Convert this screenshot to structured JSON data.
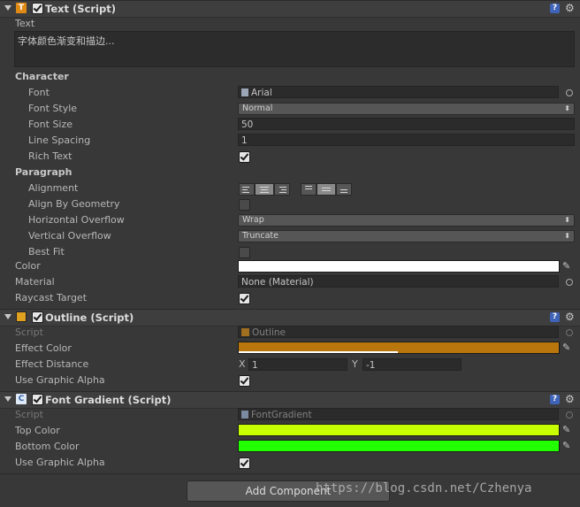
{
  "text_component": {
    "title": "Text (Script)",
    "icon_letter": "T",
    "text_label": "Text",
    "text_value": "字体颜色渐变和描边...",
    "character_section": "Character",
    "font_label": "Font",
    "font_value": "Arial",
    "font_style_label": "Font Style",
    "font_style_value": "Normal",
    "font_size_label": "Font Size",
    "font_size_value": "50",
    "line_spacing_label": "Line Spacing",
    "line_spacing_value": "1",
    "rich_text_label": "Rich Text",
    "rich_text_checked": true,
    "paragraph_section": "Paragraph",
    "alignment_label": "Alignment",
    "align_by_geometry_label": "Align By Geometry",
    "align_by_geometry_checked": false,
    "h_overflow_label": "Horizontal Overflow",
    "h_overflow_value": "Wrap",
    "v_overflow_label": "Vertical Overflow",
    "v_overflow_value": "Truncate",
    "best_fit_label": "Best Fit",
    "best_fit_checked": false,
    "color_label": "Color",
    "color_value": "#ffffff",
    "material_label": "Material",
    "material_value": "None (Material)",
    "raycast_label": "Raycast Target",
    "raycast_checked": true
  },
  "outline_component": {
    "title": "Outline (Script)",
    "script_label": "Script",
    "script_value": "Outline",
    "effect_color_label": "Effect Color",
    "effect_color_value": "#b8760c",
    "effect_distance_label": "Effect Distance",
    "x_label": "X",
    "x_value": "1",
    "y_label": "Y",
    "y_value": "-1",
    "use_graphic_alpha_label": "Use Graphic Alpha",
    "use_graphic_alpha_checked": true
  },
  "gradient_component": {
    "title": "Font Gradient (Script)",
    "icon_letter": "C",
    "script_label": "Script",
    "script_value": "FontGradient",
    "top_color_label": "Top Color",
    "top_color_value": "#c8ff00",
    "bottom_color_label": "Bottom Color",
    "bottom_color_value": "#22ff00",
    "use_graphic_alpha_label": "Use Graphic Alpha",
    "use_graphic_alpha_checked": true
  },
  "add_component_label": "Add Component",
  "watermark": "https://blog.csdn.net/Czhenya"
}
